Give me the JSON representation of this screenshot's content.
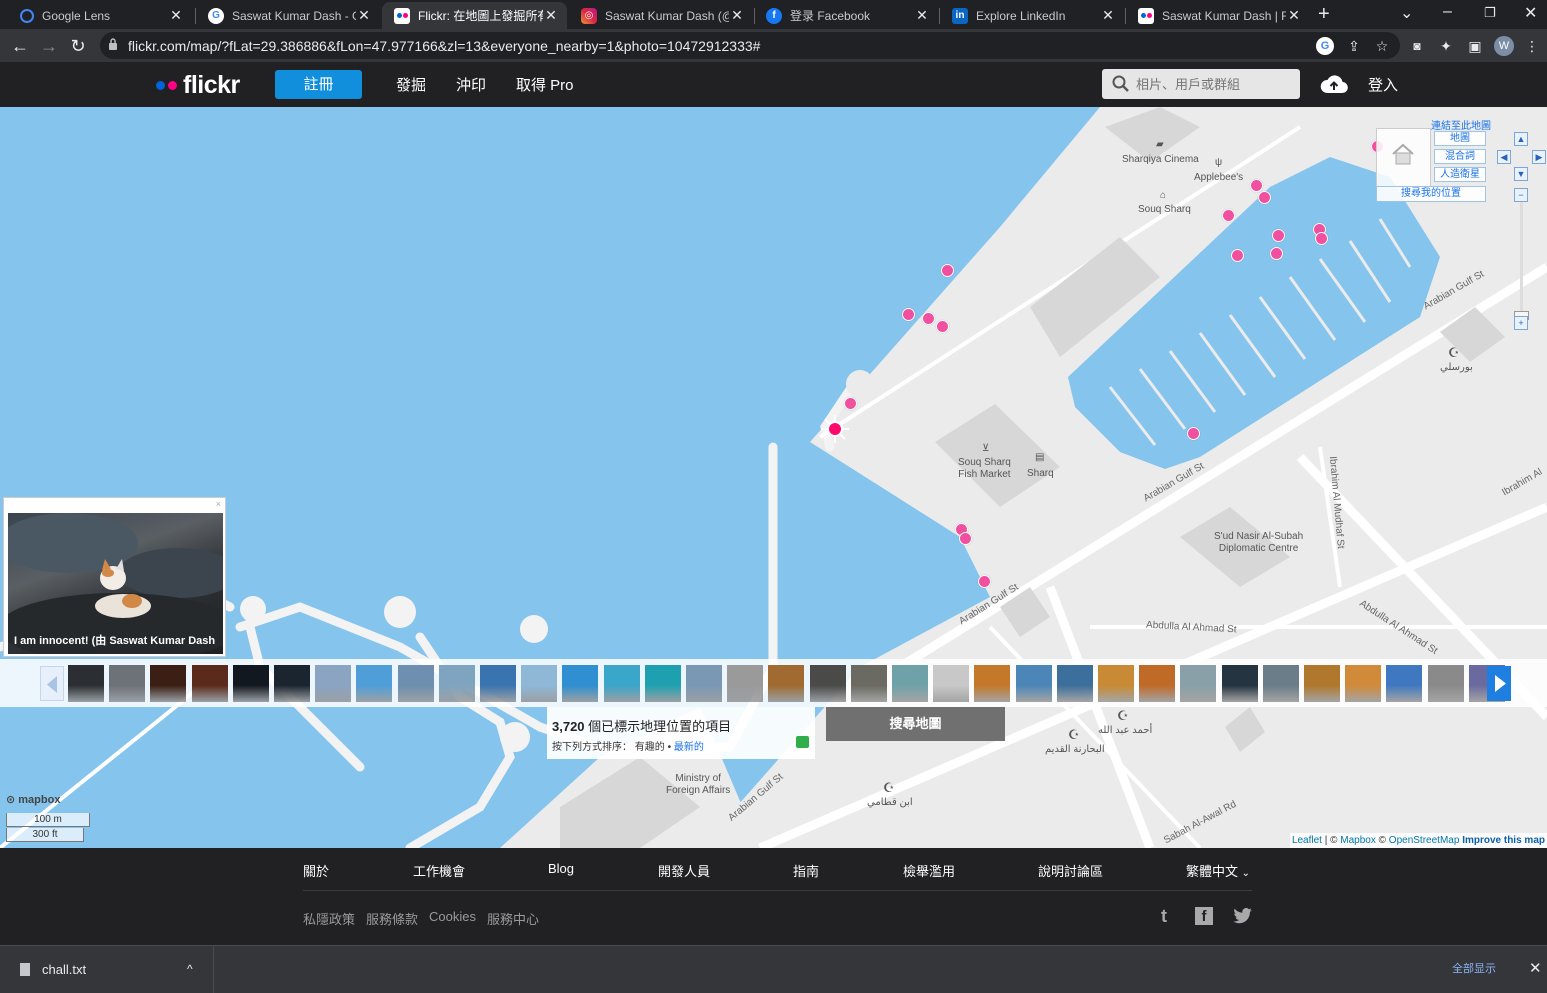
{
  "browser": {
    "tabs": [
      {
        "title": "Google Lens",
        "icon": "google-lens-icon",
        "color": "#4285f4"
      },
      {
        "title": "Saswat Kumar Dash - Go",
        "icon": "google-icon",
        "color": "#4285f4"
      },
      {
        "title": "Flickr: 在地圖上發掘所有",
        "icon": "flickr-icon",
        "color": "#0063dc"
      },
      {
        "title": "Saswat Kumar Dash (@s",
        "icon": "instagram-icon",
        "color": "#d6249f"
      },
      {
        "title": "登录 Facebook",
        "icon": "facebook-icon",
        "color": "#1877f2"
      },
      {
        "title": "Explore LinkedIn",
        "icon": "linkedin-icon",
        "color": "#0a66c2"
      },
      {
        "title": "Saswat Kumar Dash | Flic",
        "icon": "flickr-icon",
        "color": "#0063dc"
      }
    ],
    "active_tab": 2,
    "url": "flickr.com/map/?fLat=29.386886&fLon=47.977166&zl=13&everyone_nearby=1&photo=10472912333#",
    "profile_initial": "W"
  },
  "header": {
    "logo": "flickr",
    "signup": "註冊",
    "nav": [
      "發掘",
      "沖印",
      "取得 Pro"
    ],
    "search_placeholder": "相片、用戶或群組",
    "login": "登入"
  },
  "map": {
    "controls": {
      "link_to_map": "連結至此地圖",
      "map": "地圖",
      "hybrid": "混合詞",
      "satellite": "人造衛星",
      "find_my_location": "搜尋我的位置"
    },
    "places": [
      {
        "name": "Sharqiya Cinema"
      },
      {
        "name": "Applebee's"
      },
      {
        "name": "Souq Sharq"
      },
      {
        "name": "Souq Sharq\nFish Market"
      },
      {
        "name": "Sharq"
      },
      {
        "name": "S'ud Nasir Al-Subah\nDiplomatic Centre"
      },
      {
        "name": "Ministry of\nForeign Affairs"
      },
      {
        "name": "بورسلي"
      },
      {
        "name": "أحمد عبد الله"
      },
      {
        "name": "البحارنة القديم"
      },
      {
        "name": "ابن قطامي"
      }
    ],
    "streets": [
      "Arabian Gulf St",
      "Arabian Gulf St",
      "Arabian Gulf St",
      "Arabian Gulf St",
      "Abdulla Al Ahmad St",
      "Abdulla Al Ahmad St",
      "Ibrahim Al Mudhaf St",
      "Ibrahim Al",
      "Sabah Al-Awal Rd"
    ],
    "popup": {
      "caption": "I am innocent! (由 Saswat Kumar Dash",
      "close": "×"
    },
    "results": {
      "count": "3,720",
      "count_label": "個已標示地理位置的項目",
      "sort_label": "按下列方式排序：",
      "sort_interesting": "有趣的",
      "sort_separator": "•",
      "sort_recent": "最新的"
    },
    "search_map_button": "搜尋地圖",
    "mapbox": "mapbox",
    "scale": {
      "metric": "100 m",
      "imperial": "300 ft"
    },
    "attribution": {
      "leaflet": "Leaflet",
      "sep": " | © ",
      "mapbox": "Mapbox",
      "osm_prefix": " © ",
      "osm": "OpenStreetMap",
      "improve": "Improve this map"
    },
    "thumb_colors": [
      "#2b2f33",
      "#6c7278",
      "#3b1f14",
      "#5a2a1a",
      "#12181f",
      "#1b2530",
      "#8aa4c2",
      "#4f9ed8",
      "#6e8fb0",
      "#7fa4c0",
      "#3a74b0",
      "#8fb8d6",
      "#2f8fd0",
      "#3aa6c9",
      "#1fa0b0",
      "#7a98b4",
      "#9a9a9a",
      "#a06a30",
      "#4a4a48",
      "#6a6a62",
      "#6fa2a8",
      "#c8c8c8",
      "#c4782a",
      "#4c86b8",
      "#3d6f9c",
      "#c88a34",
      "#c06a28",
      "#8aa0a8",
      "#243440",
      "#6a7d88",
      "#b0782c",
      "#d08a3a",
      "#3f78c0",
      "#8a8a8a",
      "#6a6aa0"
    ]
  },
  "footer": {
    "links": [
      "關於",
      "工作機會",
      "Blog",
      "開發人員",
      "指南",
      "檢舉濫用",
      "說明討論區",
      "繁體中文"
    ],
    "secondary": [
      "私隱政策",
      "服務條款",
      "Cookies",
      "服務中心"
    ],
    "social": [
      "tumblr-icon",
      "facebook-icon",
      "twitter-icon"
    ]
  },
  "downloads": {
    "file": "chall.txt",
    "show_all": "全部显示"
  }
}
